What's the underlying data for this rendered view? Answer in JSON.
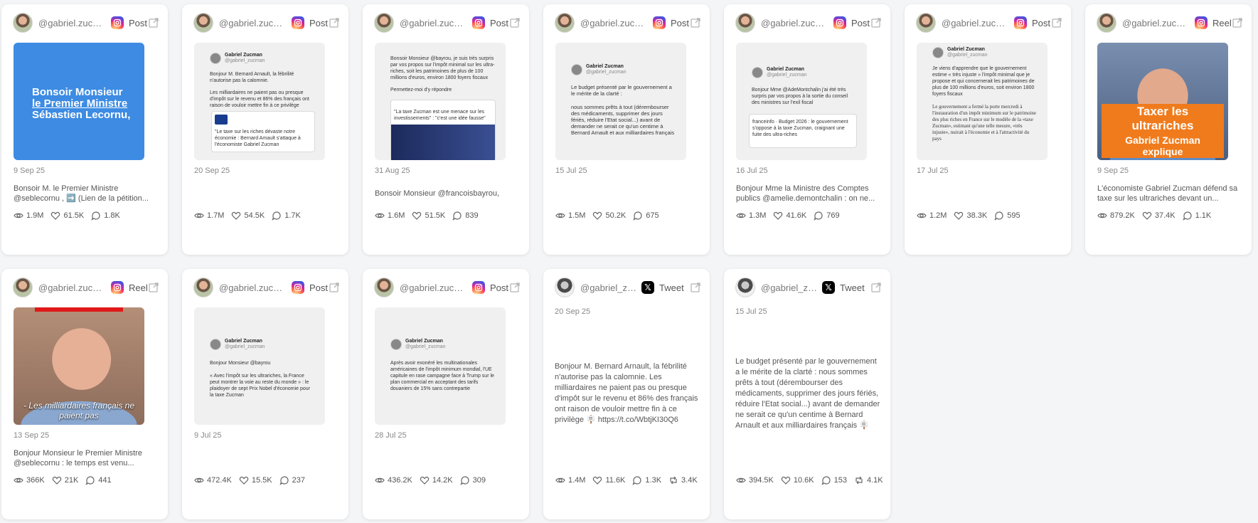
{
  "cards": [
    {
      "handle": "@gabriel.zucm...",
      "type": "Post",
      "thumb_text_1": "Bonsoir Monsieur",
      "thumb_text_2": "le Premier Ministre",
      "thumb_text_3": "Sébastien Lecornu,",
      "date": "9 Sep 25",
      "desc": "Bonsoir M. le Premier Ministre @seblecornu , ➡️ (Lien de la pétition...",
      "views": "1.9M",
      "likes": "61.5K",
      "comments": "1.8K"
    },
    {
      "handle": "@gabriel.zucm...",
      "type": "Post",
      "mini_name": "Gabriel Zucman",
      "mini_handle": "@gabriel_zucman",
      "mini_text": "Bonjour M. Bernard Arnault, la fébrilité n'autorise pas la calomnie.",
      "mini_text2": "Les milliardaires ne paient pas ou presque d'impôt sur le revenu et 86% des français ont raison de vouloir mettre fin à ce privilège",
      "mini_quote": "\"Le taxe sur les riches dévaste notre économie : Bernard Arnault s'attaque à l'économiste Gabriel Zucman",
      "date": "20 Sep 25",
      "desc": "",
      "views": "1.7M",
      "likes": "54.5K",
      "comments": "1.7K"
    },
    {
      "handle": "@gabriel.zucm...",
      "type": "Post",
      "mini_text": "Bonsoir Monsieur @bayrou, je suis très surpris par vos propos sur l'impôt minimal sur les ultra-riches, soit les patrimoines de plus de 100 millions d'euros, environ 1800 foyers fiscaux",
      "mini_text2": "Permettez-moi d'y répondre",
      "mini_quote": "\"La taxe Zucman est une menace sur les investissements\" : \"c'est une idée fausse\"",
      "date": "31 Aug 25",
      "desc": "Bonsoir Monsieur @francoisbayrou,",
      "views": "1.6M",
      "likes": "51.5K",
      "comments": "839"
    },
    {
      "handle": "@gabriel.zucm...",
      "type": "Post",
      "mini_name": "Gabriel Zucman",
      "mini_handle": "@gabriel_zucman",
      "mini_text": "Le budget présenté par le gouvernement a le mérite de la clarté :",
      "mini_text2": "nous sommes prêts à tout (dérembourser des médicaments, supprimer des jours fériés, réduire l'Etat social...) avant de demander ne serait ce qu'un centime à Bernard Arnault et aux milliardaires français",
      "date": "15 Jul 25",
      "desc": "",
      "views": "1.5M",
      "likes": "50.2K",
      "comments": "675"
    },
    {
      "handle": "@gabriel.zucm...",
      "type": "Post",
      "mini_name": "Gabriel Zucman",
      "mini_handle": "@gabriel_zucman",
      "mini_text": "Bonjour Mme @AdeMontchalin j'ai été très surpris par vos propos à la sortie du conseil des ministres sur l'exil fiscal",
      "mini_quote": "franceinfo · Budget 2026 : le gouvernement s'oppose à la taxe Zucman, craignant une fuite des ultra-riches",
      "date": "16 Jul 25",
      "desc": "Bonjour Mme la Ministre des Comptes publics @amelie.demontchalin : on ne...",
      "views": "1.3M",
      "likes": "41.6K",
      "comments": "769"
    },
    {
      "handle": "@gabriel.zucm...",
      "type": "Post",
      "mini_name": "Gabriel Zucman",
      "mini_handle": "@gabriel_zucman",
      "mini_text": "Je viens d'apprendre que le gouvernement estime « très injuste » l'impôt minimal que je propose et qui concernerait les patrimoines de plus de 100 millions d'euros, soit environ 1800 foyers fiscaux",
      "mini_text2": "Le gouvernement a fermé la porte mercredi à l'instauration d'un impôt minimum sur le patrimoine des plus riches en France sur le modèle de la «taxe Zucman», estimant qu'une telle mesure, «très injuste», nuirait à l'économie et à l'attractivité du pays",
      "date": "17 Jul 25",
      "desc": "",
      "views": "1.2M",
      "likes": "38.3K",
      "comments": "595"
    },
    {
      "handle": "@gabriel.zucm...",
      "type": "Reel",
      "caption_1": "Taxer les ultrariches",
      "caption_2": "Gabriel Zucman explique",
      "date": "9 Sep 25",
      "desc": "L'économiste Gabriel Zucman défend sa taxe sur les ultrariches devant un...",
      "views": "879.2K",
      "likes": "37.4K",
      "comments": "1.1K"
    },
    {
      "handle": "@gabriel.zucm...",
      "type": "Reel",
      "caption": "- Les milliardaires français ne paient pas",
      "date": "13 Sep 25",
      "desc": "Bonjour Monsieur le Premier Ministre @seblecornu : le temps est venu...",
      "views": "366K",
      "likes": "21K",
      "comments": "441"
    },
    {
      "handle": "@gabriel.zucm...",
      "type": "Post",
      "mini_name": "Gabriel Zucman",
      "mini_handle": "@gabriel_zucman",
      "mini_text": "Bonjour Monsieur @bayrou",
      "mini_text2": "« Avec l'impôt sur les ultrariches, la France peut montrer la voie au reste du monde » : le plaidoyer de sept Prix Nobel d'économie pour la taxe Zucman",
      "date": "9 Jul 25",
      "desc": "",
      "views": "472.4K",
      "likes": "15.5K",
      "comments": "237"
    },
    {
      "handle": "@gabriel.zucm...",
      "type": "Post",
      "mini_name": "Gabriel Zucman",
      "mini_handle": "@gabriel_zucman",
      "mini_text": "Après avoir exonéré les multinationales américaines de l'impôt minimum mondial, l'UE capitule en rase campagne face à Trump sur le plan commercial en acceptant des tarifs douaniers de 15% sans contrepartie",
      "date": "28 Jul 25",
      "desc": "",
      "views": "436.2K",
      "likes": "14.2K",
      "comments": "309"
    },
    {
      "handle": "@gabriel_zu...",
      "type": "Tweet",
      "date": "20 Sep 25",
      "text": "Bonjour M. Bernard Arnault, la fébrilité n'autorise pas la calomnie. Les milliardaires ne paient pas ou presque d'impôt sur le revenu et 86% des français ont raison de vouloir mettre fin à ce privilège 🪧 https://t.co/WbtjKI30Q6",
      "views": "1.4M",
      "likes": "11.6K",
      "comments": "1.3K",
      "retweets": "3.4K"
    },
    {
      "handle": "@gabriel_zu...",
      "type": "Tweet",
      "date": "15 Jul 25",
      "text": "Le budget présenté par le gouvernement a le mérite de la clarté : nous sommes prêts à tout (dérembourser des médicaments, supprimer des jours fériés, réduire l'Etat social...) avant de demander ne serait ce qu'un centime à Bernard Arnault et aux milliardaires français 🪧",
      "views": "394.5K",
      "likes": "10.6K",
      "comments": "153",
      "retweets": "4.1K"
    }
  ],
  "colors": {
    "accent_blue": "#3d8be3",
    "reel_orange": "#f07b1c"
  },
  "icons": [
    "avatar",
    "instagram-icon",
    "x-logo-icon",
    "external-link-icon",
    "eye-icon",
    "heart-icon",
    "comment-icon",
    "retweet-icon"
  ]
}
